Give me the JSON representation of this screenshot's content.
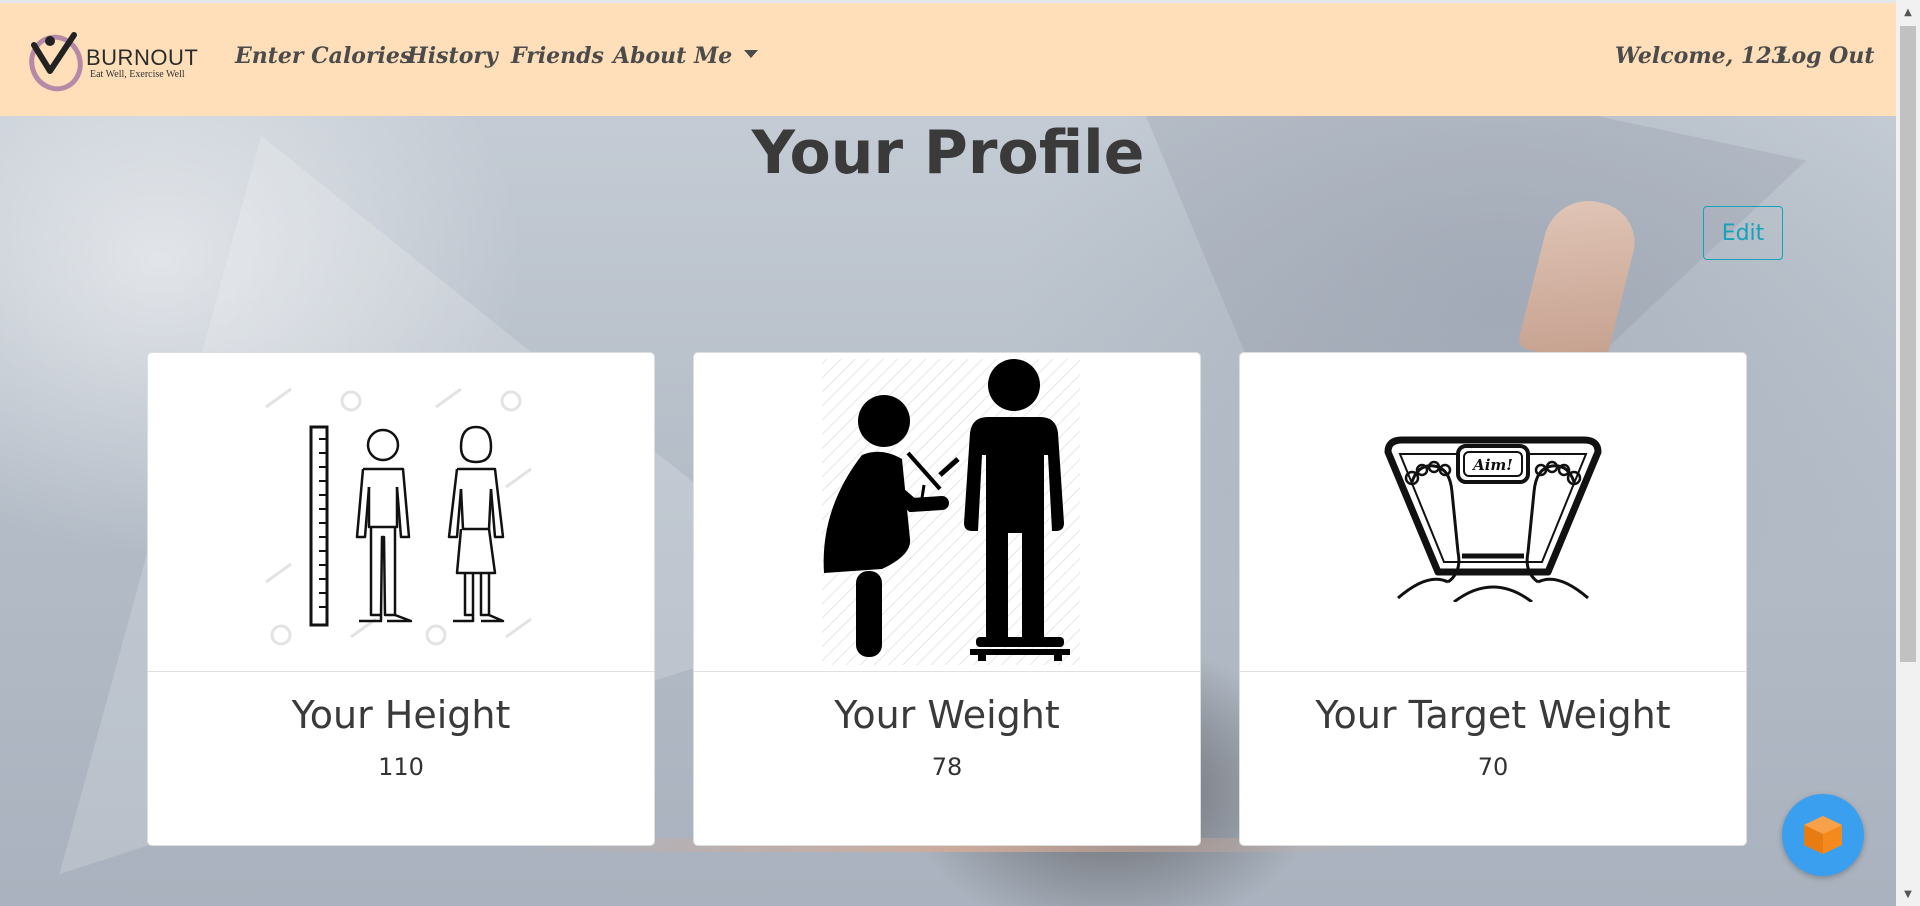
{
  "brand": {
    "name": "BURNOUT",
    "tagline": "Eat Well, Exercise Well",
    "icon": "burnout-logo"
  },
  "nav": {
    "links": [
      "Enter Calories",
      "History",
      "Friends",
      "About Me"
    ],
    "welcome": "Welcome, 123",
    "logout": "Log Out"
  },
  "page": {
    "title": "Your Profile",
    "edit_label": "Edit"
  },
  "cards": [
    {
      "title": "Your Height",
      "value": "110",
      "icon": "height-chart-illustration"
    },
    {
      "title": "Your Weight",
      "value": "78",
      "icon": "weigh-in-illustration"
    },
    {
      "title": "Your Target Weight",
      "value": "70",
      "icon": "scale-aim-illustration"
    }
  ],
  "colors": {
    "navbar": "#fedfb9",
    "edit": "#17a2b8",
    "fab": "#3b9ff0",
    "fab_cube": "#f48a1d"
  }
}
